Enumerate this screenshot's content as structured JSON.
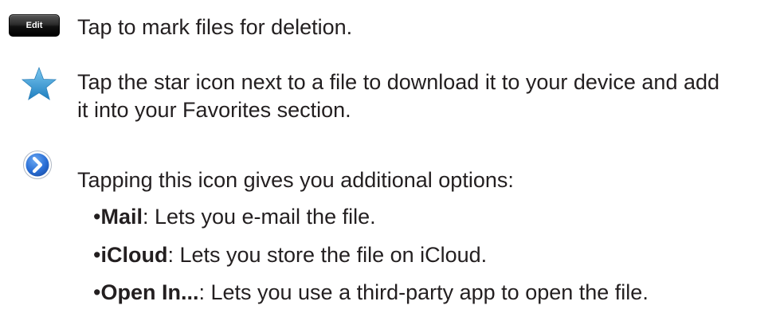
{
  "edit": {
    "button_label": "Edit",
    "text": "Tap to mark files for deletion."
  },
  "star": {
    "icon": "star-icon",
    "color": "#3aa0d8",
    "line1": "Tap the star icon next to a file to download it to your device and add",
    "line2": "it into your Favorites section."
  },
  "options": {
    "icon": "disclosure-arrow-icon",
    "color": "#1f63c4",
    "intro": "Tapping this icon gives you additional options:",
    "items": [
      {
        "bullet": "•",
        "term": "Mail",
        "desc": ": Lets you e-mail the file."
      },
      {
        "bullet": "•",
        "term": "iCloud",
        "desc": ": Lets you store the file on iCloud."
      },
      {
        "bullet": "•",
        "term": "Open In...",
        "desc": ": Lets you use a third-party app to open the file."
      }
    ]
  }
}
